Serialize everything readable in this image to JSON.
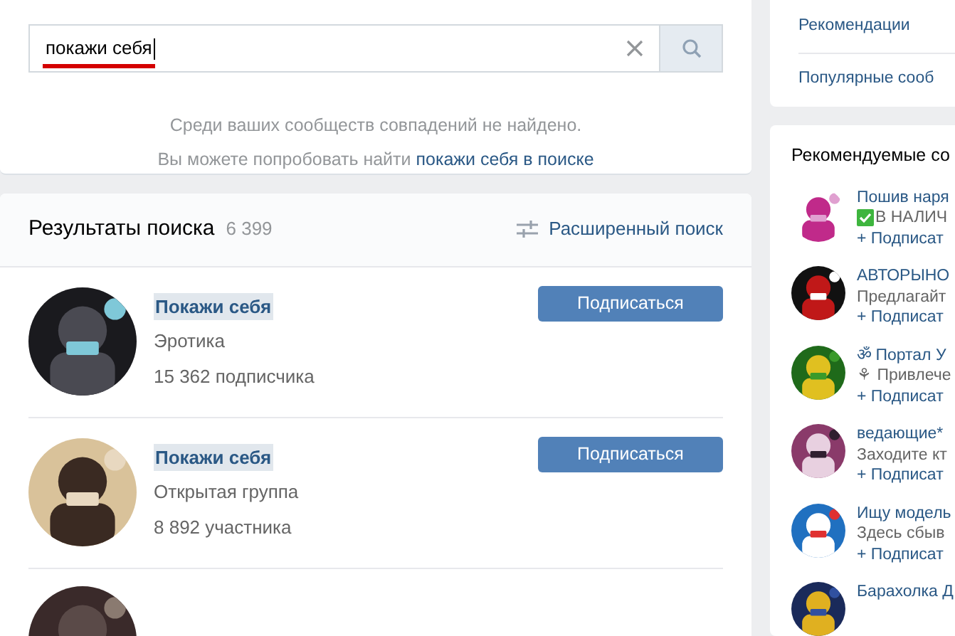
{
  "search": {
    "value": "покажи себя"
  },
  "message": {
    "line1": "Среди ваших сообществ совпадений не найдено.",
    "line2": "Вы можете попробовать найти",
    "link": "покажи себя в поиске"
  },
  "results": {
    "title": "Результаты поиска",
    "count": "6 399",
    "advanced": "Расширенный поиск",
    "items": [
      {
        "title": "Покажи себя",
        "subtitle": "Эротика",
        "members": "15 362 подписчика",
        "button": "Подписаться"
      },
      {
        "title": "Покажи себя",
        "subtitle": "Открытая группа",
        "members": "8 892 участника",
        "button": "Подписаться"
      }
    ]
  },
  "menu": [
    {
      "label": "Рекомендации"
    },
    {
      "label": "Популярные сооб"
    }
  ],
  "recommended": {
    "title": "Рекомендуемые со",
    "items": [
      {
        "title": "Пошив наря",
        "description": "В НАЛИЧ",
        "check": true,
        "subscribe": "+ Подписат"
      },
      {
        "title": "АВТОРЫНО",
        "description": "Предлагайт",
        "check": false,
        "subscribe": "+ Подписат"
      },
      {
        "title": "ॐ Портал У",
        "description": "⚘ Привлече",
        "check": false,
        "subscribe": "+ Подписат"
      },
      {
        "title": "ведающие*",
        "description": "Заходите кт",
        "check": false,
        "subscribe": "+ Подписат"
      },
      {
        "title": "Ищу модель",
        "description": "Здесь сбыв",
        "check": false,
        "subscribe": "+ Подписат"
      },
      {
        "title": "Барахолка Д"
      }
    ]
  }
}
